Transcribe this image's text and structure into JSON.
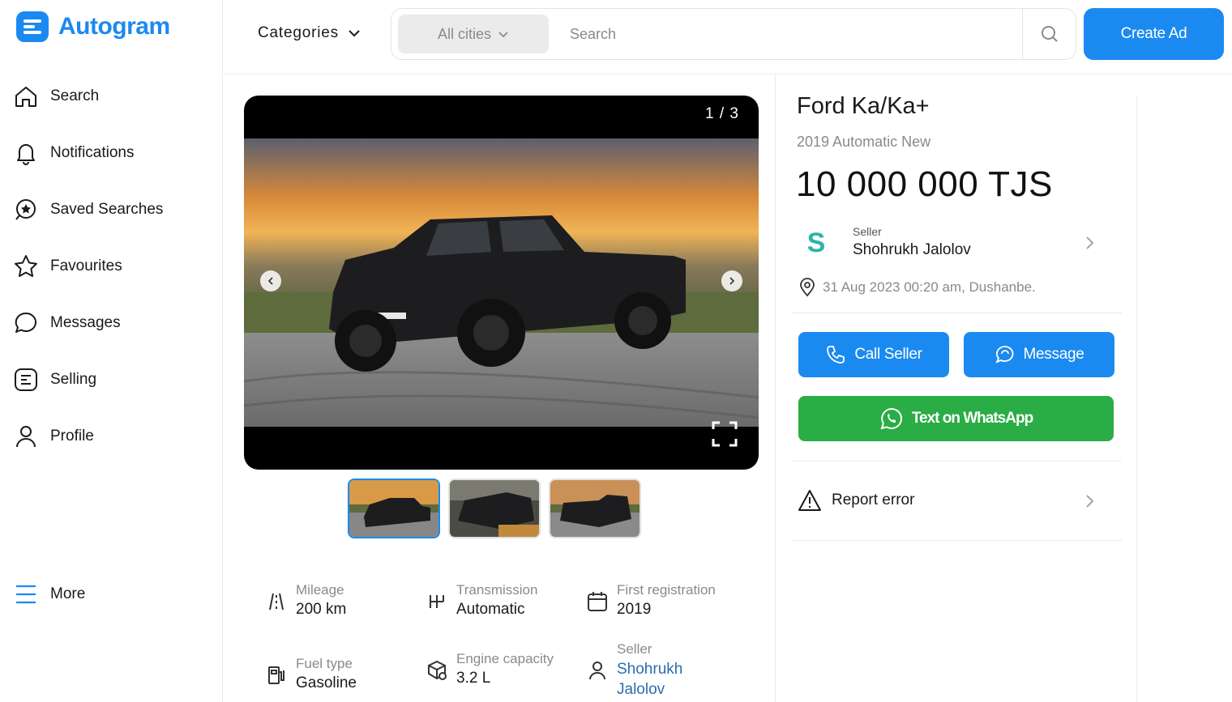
{
  "app": {
    "name": "Autogram",
    "brand_color": "#1b8af0"
  },
  "sidebar": {
    "items": [
      {
        "label": "Search",
        "icon": "home-icon"
      },
      {
        "label": "Notifications",
        "icon": "bell-icon"
      },
      {
        "label": "Saved Searches",
        "icon": "saved-search-icon"
      },
      {
        "label": "Favourites",
        "icon": "star-icon"
      },
      {
        "label": "Messages",
        "icon": "chat-icon"
      },
      {
        "label": "Selling",
        "icon": "selling-icon"
      },
      {
        "label": "Profile",
        "icon": "user-icon"
      }
    ],
    "more_label": "More"
  },
  "header": {
    "categories_label": "Categories",
    "city_selected": "All cities",
    "search_placeholder": "Search",
    "create_ad_label": "Create Ad"
  },
  "gallery": {
    "counter": "1 / 3",
    "thumbnails": [
      "thumbnail-1",
      "thumbnail-2",
      "thumbnail-3"
    ],
    "active_index": 0
  },
  "specs": {
    "mileage": {
      "label": "Mileage",
      "value": "200 km"
    },
    "transmission": {
      "label": "Transmission",
      "value": "Automatic"
    },
    "first_registration": {
      "label": "First registration",
      "value": "2019"
    },
    "fuel_type": {
      "label": "Fuel type",
      "value": "Gasoline"
    },
    "engine_capacity": {
      "label": "Engine capacity",
      "value": "3.2 L"
    },
    "seller": {
      "label": "Seller",
      "value_line1": "Shohrukh",
      "value_line2": "Jalolov"
    }
  },
  "listing": {
    "title": "Ford Ka/Ka+",
    "subtitle": "2019 Automatic New",
    "price": "10 000 000 TJS",
    "seller_label": "Seller",
    "seller_name": "Shohrukh Jalolov",
    "location": "31 Aug 2023 00:20 am, Dushanbe."
  },
  "actions": {
    "call_label": "Call Seller",
    "message_label": "Message",
    "whatsapp_label": "Text on WhatsApp",
    "report_label": "Report error"
  },
  "colors": {
    "whatsapp": "#2aad44",
    "seller_logo": "#2bb5a8"
  }
}
